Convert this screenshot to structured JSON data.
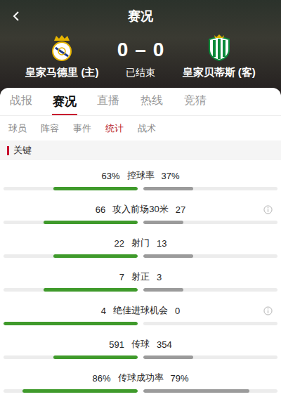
{
  "header": {
    "title": "赛况"
  },
  "match": {
    "home": {
      "name": "皇家马德里 (主)"
    },
    "away": {
      "name": "皇家贝蒂斯 (客)"
    },
    "home_score": "0",
    "separator": "–",
    "away_score": "0",
    "status": "已结束"
  },
  "tabs": [
    {
      "label": "战报",
      "selected": false
    },
    {
      "label": "赛况",
      "selected": true
    },
    {
      "label": "直播",
      "selected": false
    },
    {
      "label": "热线",
      "selected": false
    },
    {
      "label": "竞猜",
      "selected": false
    }
  ],
  "sub_tabs": [
    {
      "label": "球员",
      "selected": false
    },
    {
      "label": "阵容",
      "selected": false
    },
    {
      "label": "事件",
      "selected": false
    },
    {
      "label": "统计",
      "selected": true
    },
    {
      "label": "战术",
      "selected": false
    }
  ],
  "section": {
    "title": "关键"
  },
  "stats": [
    {
      "label": "控球率",
      "home": "63%",
      "away": "37%",
      "home_level": 0.63,
      "away_level": 0.37,
      "info": false
    },
    {
      "label": "攻入前场30米",
      "home": "66",
      "away": "27",
      "home_level": 0.7,
      "away_level": 0.3,
      "info": true
    },
    {
      "label": "射门",
      "home": "22",
      "away": "13",
      "home_level": 0.63,
      "away_level": 0.37,
      "info": false
    },
    {
      "label": "射正",
      "home": "7",
      "away": "3",
      "home_level": 0.7,
      "away_level": 0.3,
      "info": false
    },
    {
      "label": "绝佳进球机会",
      "home": "4",
      "away": "0",
      "home_level": 1,
      "away_level": 0,
      "info": true
    },
    {
      "label": "传球",
      "home": "591",
      "away": "354",
      "home_level": 0.63,
      "away_level": 0.37,
      "info": false
    },
    {
      "label": "传球成功率",
      "home": "86%",
      "away": "79%",
      "home_level": 0.86,
      "away_level": 0.79,
      "info": false
    }
  ]
}
